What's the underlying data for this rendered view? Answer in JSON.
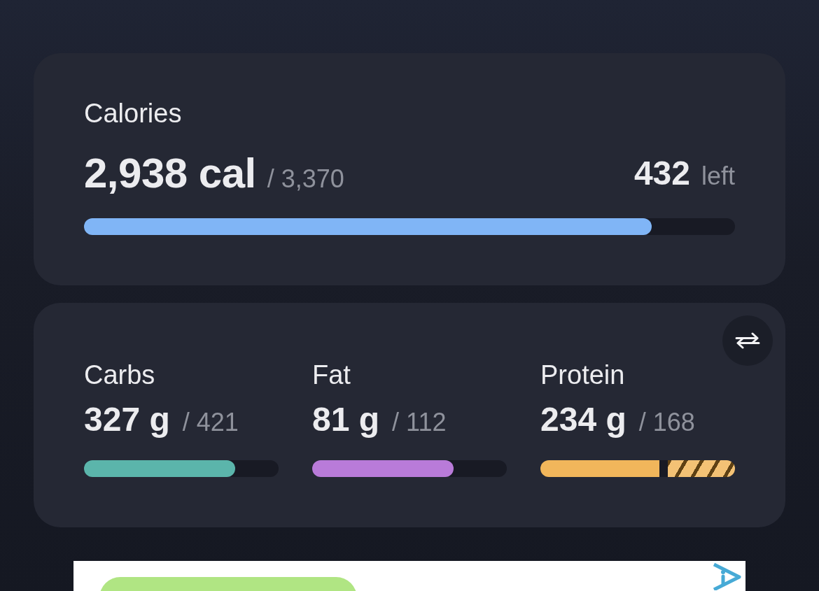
{
  "calories": {
    "title": "Calories",
    "consumed": "2,938 cal",
    "goal": "/ 3,370",
    "remaining": "432",
    "remaining_label": "left",
    "level": 0.872
  },
  "macros_card": {
    "actions": [
      {
        "kind": "swap"
      }
    ],
    "macros": [
      {
        "name": "Carbs",
        "amount": "327 g",
        "goal": "/ 421",
        "color": "#5bb5ab",
        "bar": [
          {
            "kind": "fill",
            "level": 0.777
          }
        ]
      },
      {
        "name": "Fat",
        "amount": "81 g",
        "goal": "/ 112",
        "color": "#b97bd9",
        "bar": [
          {
            "kind": "fill",
            "level": 0.727
          }
        ]
      },
      {
        "name": "Protein",
        "amount": "234 g",
        "goal": "/ 168",
        "color": "#f1b65b",
        "bar": [
          {
            "kind": "fill",
            "level": 0.612
          },
          {
            "kind": "excess",
            "level": 0.345
          }
        ]
      }
    ]
  },
  "advertisement": {
    "kind": "banner"
  }
}
